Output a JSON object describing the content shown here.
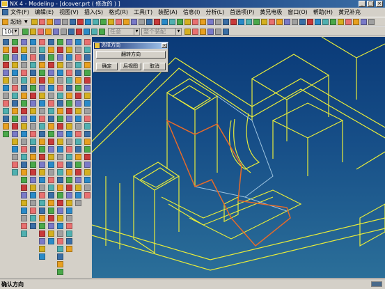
{
  "window": {
    "title": "NX 4 - Modeling - [dcover.prt ( 修改的 ) ]",
    "controls": [
      "_",
      "□",
      "×"
    ]
  },
  "menubar": {
    "items": [
      "文件(F)",
      "编辑(E)",
      "视图(V)",
      "插入(S)",
      "格式(R)",
      "工具(T)",
      "装配(A)",
      "信息(I)",
      "分析(L)",
      "首选项(P)",
      "黄兄电极",
      "窗口(O)",
      "帮助(H)",
      "黄兄补充"
    ]
  },
  "toolbar1": {
    "start_label": "起始",
    "start_arrow": "▼"
  },
  "toolbar2": {
    "zoom_value": "100",
    "filter_value": "任意",
    "assembly_value": "整个装配"
  },
  "dialog": {
    "title": "选择方向",
    "flip_button": "翻转方向",
    "ok_button": "确定",
    "back_button": "后视图",
    "cancel_button": "取消"
  },
  "statusbar": {
    "text": "确认方向"
  },
  "colors": {
    "title_bar": "#0a246a",
    "viewport_top": "#0a3a78",
    "viewport_bottom": "#2b6f99",
    "wireframe": "#e8ec3a",
    "highlight_edge": "#e86a28",
    "light_edge": "#9ec4e0"
  }
}
